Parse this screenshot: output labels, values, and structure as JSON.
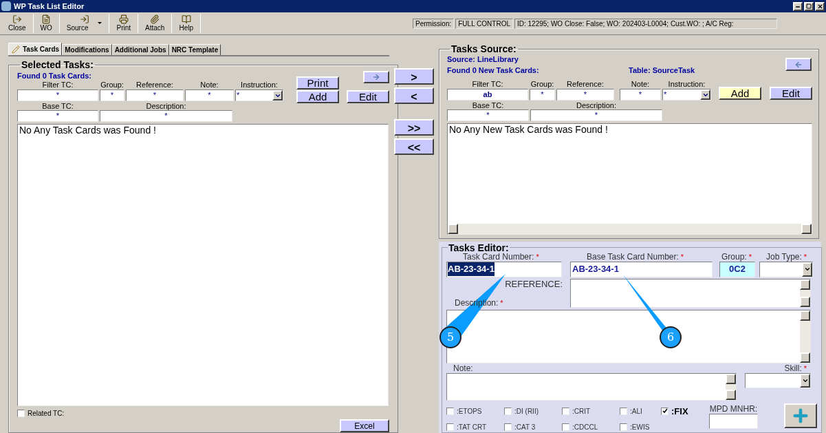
{
  "window": {
    "title": "WP Task List Editor"
  },
  "toolbar": [
    {
      "label": "Close",
      "kind": "button"
    },
    {
      "label": "WO",
      "kind": "button"
    },
    {
      "label": "Source",
      "kind": "menu"
    },
    {
      "label": "Print",
      "kind": "button"
    },
    {
      "label": "Attach",
      "kind": "button"
    },
    {
      "label": "Help",
      "kind": "button"
    }
  ],
  "status": {
    "permission_label": "Permission:",
    "permission": "FULL CONTROL",
    "info": "ID: 12295; WO Close: False; WO: 202403-L0004; Cust.WO: ; A/C Reg:"
  },
  "tabs": [
    {
      "label": "Task Cards",
      "selected": true
    },
    {
      "label": "Modifications",
      "selected": false
    },
    {
      "label": "Additional Jobs",
      "selected": false
    },
    {
      "label": "NRC Template",
      "selected": false
    }
  ],
  "selected_tasks": {
    "title": "Selected Tasks:",
    "found": "Found 0 Task Cards:",
    "filters": [
      {
        "label": "Filter TC:",
        "value": "*"
      },
      {
        "label": "Group:",
        "value": "*"
      },
      {
        "label": "Reference:",
        "value": "*"
      },
      {
        "label": "Note:",
        "value": "*"
      }
    ],
    "instruction": {
      "label": "Instruction:",
      "value": "*"
    },
    "base_filters": [
      {
        "label": "Base TC:",
        "value": "*"
      },
      {
        "label": "Description:",
        "value": "*"
      }
    ],
    "print": "Print",
    "add": "Add",
    "edit": "Edit",
    "message": "No Any Task Cards was Found !",
    "related": {
      "label": "Related TC:",
      "checked": false
    },
    "excel": "Excel"
  },
  "transfer_buttons": [
    ">",
    "<",
    ">>",
    "<<"
  ],
  "tasks_source": {
    "title": "Tasks Source:",
    "source": "Source: LineLibrary",
    "found": "Found 0 New Task Cards:",
    "table": "Table: SourceTask",
    "filters": [
      {
        "label": "Filter TC:",
        "value": "ab"
      },
      {
        "label": "Group:",
        "value": "*"
      },
      {
        "label": "Reference:",
        "value": "*"
      },
      {
        "label": "Note:",
        "value": "*"
      }
    ],
    "instruction": {
      "label": "Instruction:",
      "value": "*"
    },
    "base_filters": [
      {
        "label": "Base TC:",
        "value": "*"
      },
      {
        "label": "Description:",
        "value": "*"
      }
    ],
    "add": "Add",
    "edit": "Edit",
    "message": "No Any New Task Cards was Found !"
  },
  "tasks_editor": {
    "title": "Tasks Editor:",
    "task_card_number": {
      "label": "Task Card Number:",
      "mark": "*",
      "value": "AB-23-34-1"
    },
    "base_task_card_number": {
      "label": "Base Task Card Number:",
      "mark": "*",
      "value": "AB-23-34-1"
    },
    "group": {
      "label": "Group:",
      "mark": "*",
      "value": "0C2"
    },
    "job_type": {
      "label": "Job Type:",
      "mark": "*"
    },
    "reference": {
      "label": "REFERENCE:"
    },
    "description": {
      "label": "Description:",
      "mark": "*"
    },
    "note": {
      "label": "Note:"
    },
    "skill": {
      "label": "Skill:",
      "mark": "*"
    },
    "flags": [
      {
        "label": ":ETOPS",
        "checked": false
      },
      {
        "label": ":DI (RII)",
        "checked": false
      },
      {
        "label": ":CRIT",
        "checked": false
      },
      {
        "label": ":ALI",
        "checked": false
      },
      {
        "label": ":FIX",
        "checked": true
      },
      {
        "label": ":TAT CRT",
        "checked": false
      },
      {
        "label": ":CAT 3",
        "checked": false
      },
      {
        "label": ":CDCCL",
        "checked": false
      },
      {
        "label": ":EWIS",
        "checked": false
      }
    ],
    "mpd_label": "MPD MNHR:"
  },
  "callouts": [
    {
      "label": "5"
    },
    {
      "label": "6"
    }
  ]
}
